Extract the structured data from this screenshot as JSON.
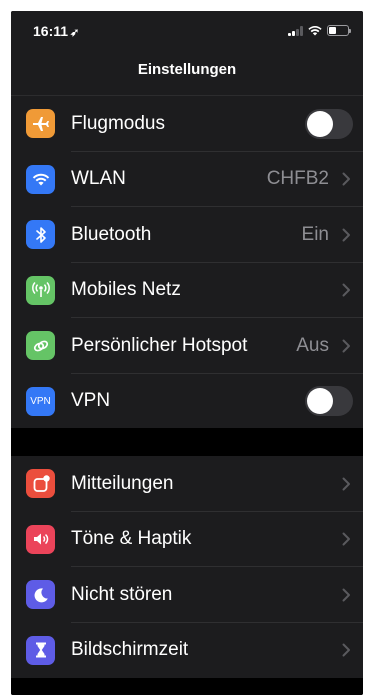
{
  "statusbar": {
    "time": "16:11"
  },
  "nav": {
    "title": "Einstellungen"
  },
  "group1": [
    {
      "label": "Flugmodus",
      "icon": "airplane-icon",
      "color": "#f09a37",
      "type": "toggle",
      "toggle_on": false
    },
    {
      "label": "WLAN",
      "icon": "wifi-icon",
      "color": "#3478f6",
      "type": "value",
      "value": "CHFB2"
    },
    {
      "label": "Bluetooth",
      "icon": "bluetooth-icon",
      "color": "#3478f6",
      "type": "value",
      "value": "Ein"
    },
    {
      "label": "Mobiles Netz",
      "icon": "antenna-icon",
      "color": "#65c466",
      "type": "chevron"
    },
    {
      "label": "Persönlicher Hotspot",
      "icon": "hotspot-icon",
      "color": "#65c466",
      "type": "value",
      "value": "Aus"
    },
    {
      "label": "VPN",
      "icon": "vpn-icon",
      "icon_text": "VPN",
      "color": "#3478f6",
      "type": "toggle",
      "toggle_on": false
    }
  ],
  "group2": [
    {
      "label": "Mitteilungen",
      "icon": "notifications-icon",
      "color": "#eb4e3d",
      "type": "chevron"
    },
    {
      "label": "Töne & Haptik",
      "icon": "speaker-icon",
      "color": "#eb445a",
      "type": "chevron"
    },
    {
      "label": "Nicht stören",
      "icon": "moon-icon",
      "color": "#5e5ce6",
      "type": "chevron"
    },
    {
      "label": "Bildschirmzeit",
      "icon": "hourglass-icon",
      "color": "#5e5ce6",
      "type": "chevron"
    }
  ]
}
